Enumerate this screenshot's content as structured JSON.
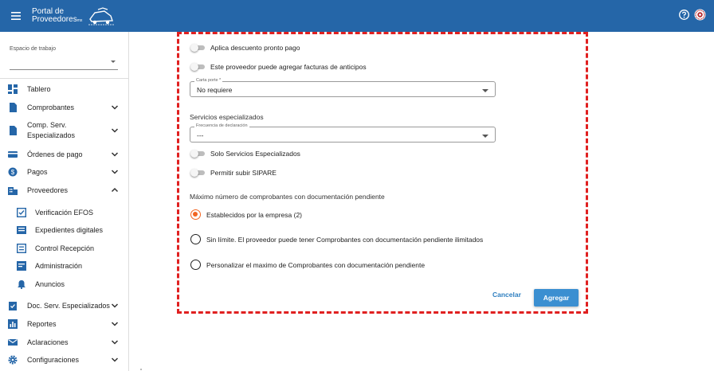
{
  "header": {
    "brand_line1": "Portal de",
    "brand_line2": "Proveedores",
    "brand_suffix": "mx",
    "accent_color": "#2566a8",
    "icons": [
      "menu-icon",
      "help-icon",
      "seal-icon"
    ]
  },
  "sidebar": {
    "workspace_label": "Espacio de trabajo",
    "workspace_value": "",
    "items": [
      {
        "label": "Tablero",
        "icon": "dashboard-icon"
      },
      {
        "label": "Comprobantes",
        "icon": "document-icon",
        "chevron": "down"
      },
      {
        "label": "Comp. Serv. Especializados",
        "icon": "document-icon",
        "chevron": "down"
      },
      {
        "label": "Órdenes de pago",
        "icon": "card-icon",
        "chevron": "down"
      },
      {
        "label": "Pagos",
        "icon": "money-icon",
        "chevron": "down"
      },
      {
        "label": "Proveedores",
        "icon": "building-icon",
        "chevron": "up"
      },
      {
        "label": "Verificación EFOS",
        "icon": "check-square-icon",
        "sub": true
      },
      {
        "label": "Expedientes digitales",
        "icon": "folder-icon",
        "sub": true
      },
      {
        "label": "Control Recepción",
        "icon": "list-icon",
        "sub": true
      },
      {
        "label": "Administración",
        "icon": "admin-icon",
        "sub": true
      },
      {
        "label": "Anuncios",
        "icon": "bell-icon",
        "sub": true
      },
      {
        "label": "Doc. Serv. Especializados",
        "icon": "clipboard-check-icon",
        "chevron": "down"
      },
      {
        "label": "Reportes",
        "icon": "report-icon",
        "chevron": "down"
      },
      {
        "label": "Aclaraciones",
        "icon": "mail-icon",
        "chevron": "down"
      },
      {
        "label": "Configuraciones",
        "icon": "gear-icon",
        "chevron": "down"
      }
    ]
  },
  "form": {
    "toggles_top": [
      {
        "label": "Aplica descuento pronto pago",
        "on": false
      },
      {
        "label": "Este proveedor puede agregar facturas de anticipos",
        "on": false
      }
    ],
    "carta_porte": {
      "legend": "Carta porte *",
      "value": "No requiere"
    },
    "servicios_title": "Servicios especializados",
    "frecuencia": {
      "legend": "Frecuencia de declaración",
      "value": "---"
    },
    "toggles_bottom": [
      {
        "label": "Solo Servicios Especializados",
        "on": false
      },
      {
        "label": "Permitir subir SIPARE",
        "on": false
      }
    ],
    "maximo_title": "Máximo número de comprobantes con documentación pendiente",
    "radios": [
      {
        "label": "Establecidos por la empresa (2)",
        "checked": true
      },
      {
        "label": "Sin límite. El proveedor puede tener Comprobantes con documentación pendiente ilimitados",
        "checked": false
      },
      {
        "label": "Personalizar el maximo de Comprobantes con documentación pendiente",
        "checked": false
      }
    ],
    "cancel_label": "Cancelar",
    "add_label": "Agregar",
    "radio_color": "#f26522",
    "button_color": "#3b8fd1"
  }
}
